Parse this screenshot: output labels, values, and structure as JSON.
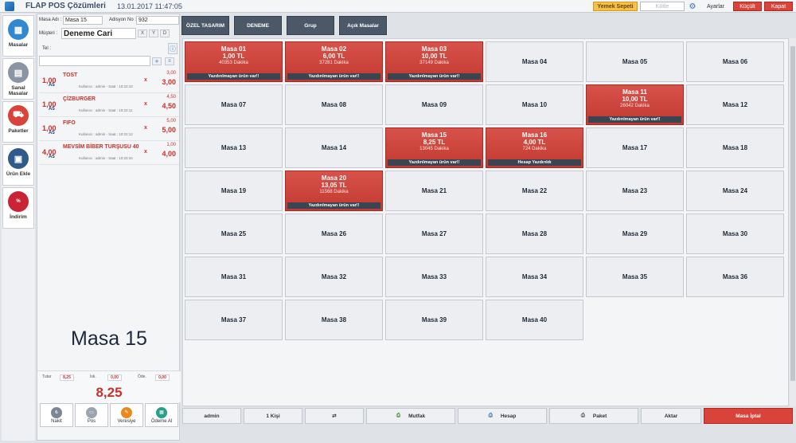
{
  "titlebar": {
    "app_title": "FLAP POS Çözümleri",
    "datetime": "13.01.2017 11:47:05",
    "yemek_sepeti": "Yemek Sepeti",
    "kilitle": "Kilitle",
    "ayarlar": "Ayarlar",
    "kucult": "Küçült",
    "kapat": "Kapat"
  },
  "nav": [
    {
      "label": "Masalar",
      "icon": "tables-icon",
      "color": "#2f88d0"
    },
    {
      "label": "Sanal Masalar",
      "icon": "cash-register-icon",
      "color": "#8a95a3"
    },
    {
      "label": "Paketler",
      "icon": "scooter-icon",
      "color": "#d8443a"
    },
    {
      "label": "Ürün Ekle",
      "icon": "menu-book-icon",
      "color": "#2f5a8a"
    },
    {
      "label": "İndirim",
      "icon": "discount-icon",
      "color": "#c92436"
    }
  ],
  "order": {
    "masa_adi_label": "Masa Adı :",
    "masa_adi": "Masa 15",
    "adisyon_label": "Adisyon No :",
    "adisyon": "932",
    "musteri_label": "Müşteri :",
    "musteri": "Deneme Cari",
    "tel_label": "Tel :",
    "items": [
      {
        "qty": "1,00",
        "pics": "A5",
        "name": "TOST",
        "meta": "Kullanıcı : admin - Saat : 10:22:10",
        "unit": "3,00",
        "total": "3,00"
      },
      {
        "qty": "1,00",
        "pics": "A5",
        "name": "ÇİZBURGER",
        "meta": "Kullanıcı : admin - Saat : 10:22:11",
        "unit": "4,50",
        "total": "4,50"
      },
      {
        "qty": "1,00",
        "pics": "A5",
        "name": "FIFO",
        "meta": "Kullanıcı : admin - Saat : 10:22:12",
        "unit": "5,00",
        "total": "5,00"
      },
      {
        "qty": "4,00",
        "pics": "A5",
        "name": "MEVSİM BİBER TURŞUSU 40",
        "meta": "Kullanıcı : admin - Saat : 10:23:34",
        "unit": "1,00",
        "total": "4,00"
      }
    ],
    "big_table": "Masa 15",
    "tutar_label": "Tutar",
    "tutar": "8,25",
    "iskonto_label": "İsk.",
    "iskonto": "0,00",
    "odenen_label": "Öde.",
    "odenen": "0,00",
    "grand_total": "8,25",
    "pay_buttons": [
      {
        "label": "Nakit",
        "icon": "cash-icon"
      },
      {
        "label": "Pos",
        "icon": "pos-icon"
      },
      {
        "label": "Veresiye",
        "icon": "credit-icon"
      },
      {
        "label": "Ödeme Al",
        "icon": "payment-icon"
      }
    ]
  },
  "tabs": [
    "ÖZEL TASARIM",
    "DENEME",
    "Grup",
    "Açık Masalar"
  ],
  "tables": [
    {
      "name": "Masa 01",
      "busy": true,
      "amount": "1,00 TL",
      "minutes": "40353 Dakika",
      "footer": "Yazdırılmayan ürün var!!"
    },
    {
      "name": "Masa 02",
      "busy": true,
      "amount": "6,00 TL",
      "minutes": "37281 Dakika",
      "footer": "Yazdırılmayan ürün var!!"
    },
    {
      "name": "Masa 03",
      "busy": true,
      "amount": "10,00 TL",
      "minutes": "37149 Dakika",
      "footer": "Yazdırılmayan ürün var!!"
    },
    {
      "name": "Masa 04"
    },
    {
      "name": "Masa 05"
    },
    {
      "name": "Masa 06"
    },
    {
      "name": "Masa 07"
    },
    {
      "name": "Masa 08"
    },
    {
      "name": "Masa 09"
    },
    {
      "name": "Masa 10"
    },
    {
      "name": "Masa 11",
      "busy": true,
      "amount": "10,00 TL",
      "minutes": "26042 Dakika",
      "footer": "Yazdırılmayan ürün var!!"
    },
    {
      "name": "Masa 12"
    },
    {
      "name": "Masa 13"
    },
    {
      "name": "Masa 14"
    },
    {
      "name": "Masa 15",
      "busy": true,
      "amount": "8,25 TL",
      "minutes": "13045 Dakika",
      "footer": "Yazdırılmayan ürün var!!"
    },
    {
      "name": "Masa 16",
      "busy": true,
      "amount": "4,00 TL",
      "minutes": "724 Dakika",
      "footer": "Hesap Yazdırıldı"
    },
    {
      "name": "Masa 17"
    },
    {
      "name": "Masa 18"
    },
    {
      "name": "Masa 19"
    },
    {
      "name": "Masa 20",
      "busy": true,
      "amount": "13,05 TL",
      "minutes": "11568 Dakika",
      "footer": "Yazdırılmayan ürün var!!"
    },
    {
      "name": "Masa 21"
    },
    {
      "name": "Masa 22"
    },
    {
      "name": "Masa 23"
    },
    {
      "name": "Masa 24"
    },
    {
      "name": "Masa 25"
    },
    {
      "name": "Masa 26"
    },
    {
      "name": "Masa 27"
    },
    {
      "name": "Masa 28"
    },
    {
      "name": "Masa 29"
    },
    {
      "name": "Masa 30"
    },
    {
      "name": "Masa 31"
    },
    {
      "name": "Masa 32"
    },
    {
      "name": "Masa 33"
    },
    {
      "name": "Masa 34"
    },
    {
      "name": "Masa 35"
    },
    {
      "name": "Masa 36"
    },
    {
      "name": "Masa 37"
    },
    {
      "name": "Masa 38"
    },
    {
      "name": "Masa 39"
    },
    {
      "name": "Masa 40"
    }
  ],
  "bottom": [
    {
      "label": "admin",
      "icon": ""
    },
    {
      "label": "1 Kişi",
      "icon": ""
    },
    {
      "label": "",
      "icon": "transfer-icon"
    },
    {
      "label": "Mutfak",
      "icon": "kitchen-printer-icon"
    },
    {
      "label": "Hesap",
      "icon": "bill-printer-icon"
    },
    {
      "label": "Paket",
      "icon": "package-printer-icon"
    },
    {
      "label": "Aktar",
      "icon": ""
    },
    {
      "label": "Masa İptal",
      "icon": ""
    }
  ],
  "colors": {
    "accent_red": "#d8443a",
    "busy_table": "#c23a32",
    "tab_dark": "#4a5867"
  }
}
